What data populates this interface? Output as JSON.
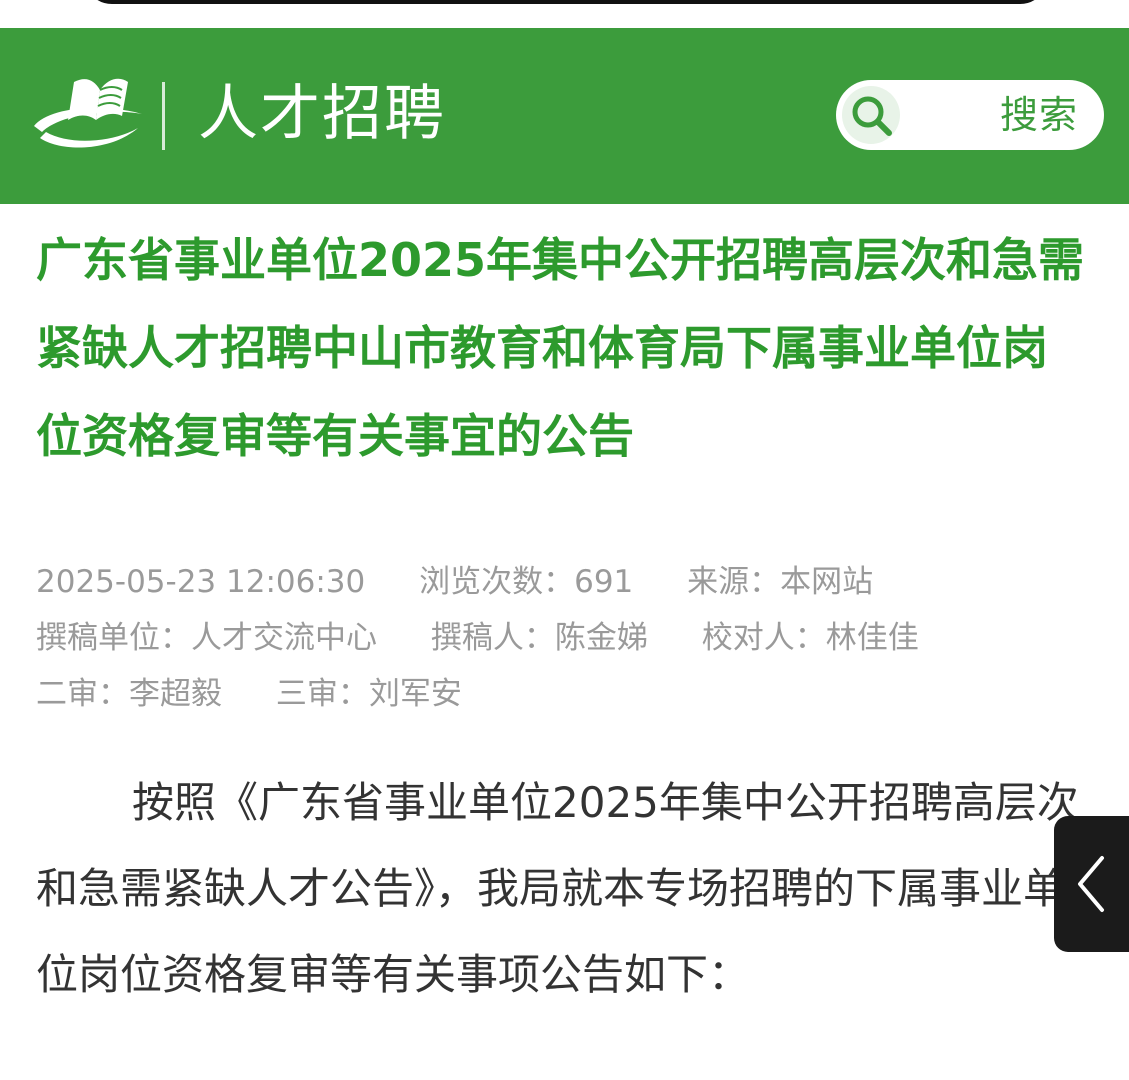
{
  "header": {
    "site_title": "人才招聘",
    "search_label": "搜索",
    "logo_icon": "open-book-globe-icon",
    "search_icon": "magnifier-icon",
    "brand_color": "#3c9c3c"
  },
  "article": {
    "title": "广东省事业单位2025年集中公开招聘高层次和急需紧缺人才招聘中山市教育和体育局下属事业单位岗位资格复审等有关事宜的公告",
    "title_color": "#2d9a2d",
    "meta": {
      "date": "2025-05-23 12:06:30",
      "views": "浏览次数：691",
      "source": "来源：本网站",
      "unit": "撰稿单位：人才交流中心",
      "author": "撰稿人：陈金娣",
      "proofreader": "校对人：林佳佳",
      "second_review": "二审：李超毅",
      "third_review": "三审：刘军安"
    },
    "body": "按照《广东省事业单位2025年集中公开招聘高层次和急需紧缺人才公告》，我局就本专场招聘的下属事业单位岗位资格复审等有关事项公告如下："
  },
  "side_button": {
    "icon": "chevron-left-icon"
  }
}
